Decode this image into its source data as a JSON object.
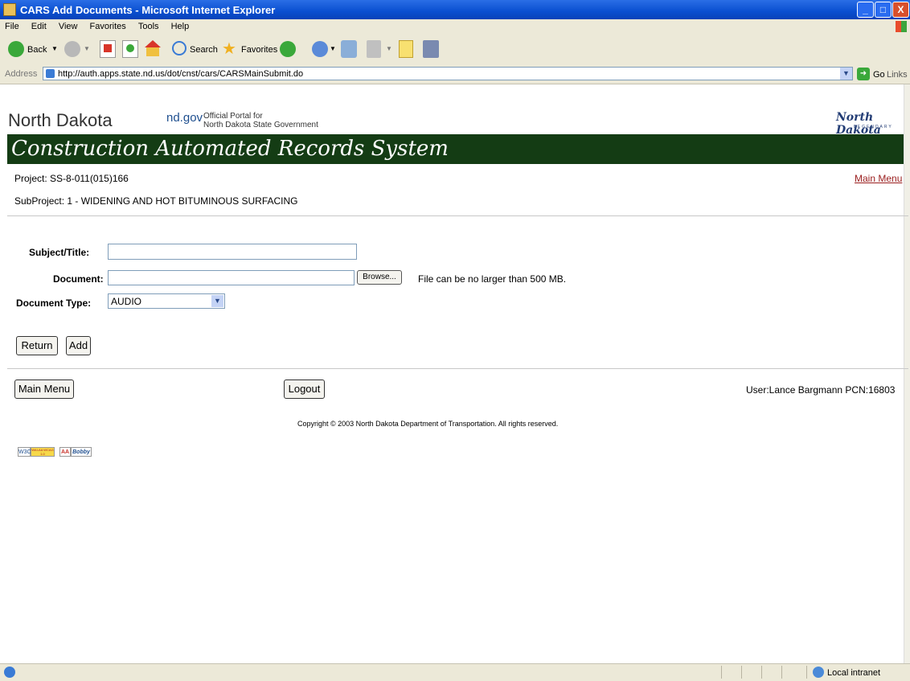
{
  "window": {
    "title": "CARS Add Documents - Microsoft Internet Explorer",
    "buttons": [
      "_",
      "□",
      "X"
    ]
  },
  "menu": [
    "File",
    "Edit",
    "View",
    "Favorites",
    "Tools",
    "Help"
  ],
  "toolbar": {
    "back_label": "Back",
    "search_label": "Search",
    "favorites_label": "Favorites"
  },
  "address": {
    "label": "Address",
    "url": "http://auth.apps.state.nd.us/dot/cnst/cars/CARSMainSubmit.do",
    "go_label": "Go",
    "links_label": "Links"
  },
  "portal": {
    "state_name": "North Dakota",
    "ndgov": "nd.gov",
    "tagline_line1": "Official Portal for",
    "tagline_line2": "North Dakota State Government",
    "logo_text": "North Dakota",
    "logo_sub": "LEGENDARY"
  },
  "banner": {
    "title": "Construction Automated Records System"
  },
  "project": {
    "project_line": "Project: SS-8-011(015)166",
    "subproject_line": "SubProject: 1 - WIDENING AND HOT BITUMINOUS SURFACING",
    "main_menu_link": "Main Menu"
  },
  "form": {
    "subject_label": "Subject/Title:",
    "subject_value": "",
    "document_label": "Document:",
    "document_value": "",
    "browse_label": "Browse...",
    "size_note": "File can be no larger than 500 MB.",
    "type_label": "Document Type:",
    "type_value": "AUDIO",
    "return_label": "Return",
    "add_label": "Add"
  },
  "footer": {
    "main_menu_label": "Main Menu",
    "logout_label": "Logout",
    "user_info": "User:Lance Bargmann  PCN:16803",
    "copyright": "Copyright © 2003 North Dakota Department of Transportation. All rights reserved.",
    "badge_w3c": "W3C",
    "badge_wai": "WAI-AA WCAG 1.0",
    "badge_aa": "AA",
    "badge_bobby": "Bobby"
  },
  "status": {
    "zone": "Local intranet"
  },
  "colors": {
    "banner": "#143c14",
    "link": "#9b2020",
    "titlebar": "#0a4fd0",
    "chrome": "#ece9d8"
  }
}
